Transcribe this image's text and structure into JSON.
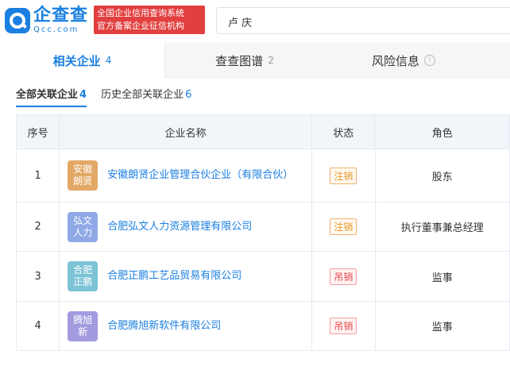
{
  "header": {
    "logo_cn": "企查查",
    "logo_en": "Qcc.com",
    "slogan_line1": "全国企业信用查询系统",
    "slogan_line2": "官方备案企业征信机构",
    "search_value": "卢    庆"
  },
  "tabs": [
    {
      "label": "相关企业",
      "count": "4"
    },
    {
      "label": "查查图谱",
      "count": "2"
    },
    {
      "label": "风险信息",
      "count": ""
    }
  ],
  "subtabs": [
    {
      "label": "全部关联企业",
      "count": "4"
    },
    {
      "label": "历史全部关联企业",
      "count": "6"
    }
  ],
  "table": {
    "headers": [
      "序号",
      "企业名称",
      "状态",
      "角色"
    ],
    "rows": [
      {
        "index": "1",
        "avatar": "安徽朗贤",
        "avatar_color": "#e3a866",
        "company": "安徽朗贤企业管理合伙企业（有限合伙）",
        "status": "注销",
        "role": "股东"
      },
      {
        "index": "2",
        "avatar": "弘文人力",
        "avatar_color": "#8fa8e6",
        "company": "合肥弘文人力资源管理有限公司",
        "status": "注销",
        "role": "执行董事兼总经理"
      },
      {
        "index": "3",
        "avatar": "合肥正鹏",
        "avatar_color": "#7cc3d6",
        "company": "合肥正鹏工艺品贸易有限公司",
        "status": "吊销",
        "role": "监事"
      },
      {
        "index": "4",
        "avatar": "腾旭新",
        "avatar_color": "#a39be0",
        "company": "合肥腾旭新软件有限公司",
        "status": "吊销",
        "role": "监事"
      }
    ]
  }
}
